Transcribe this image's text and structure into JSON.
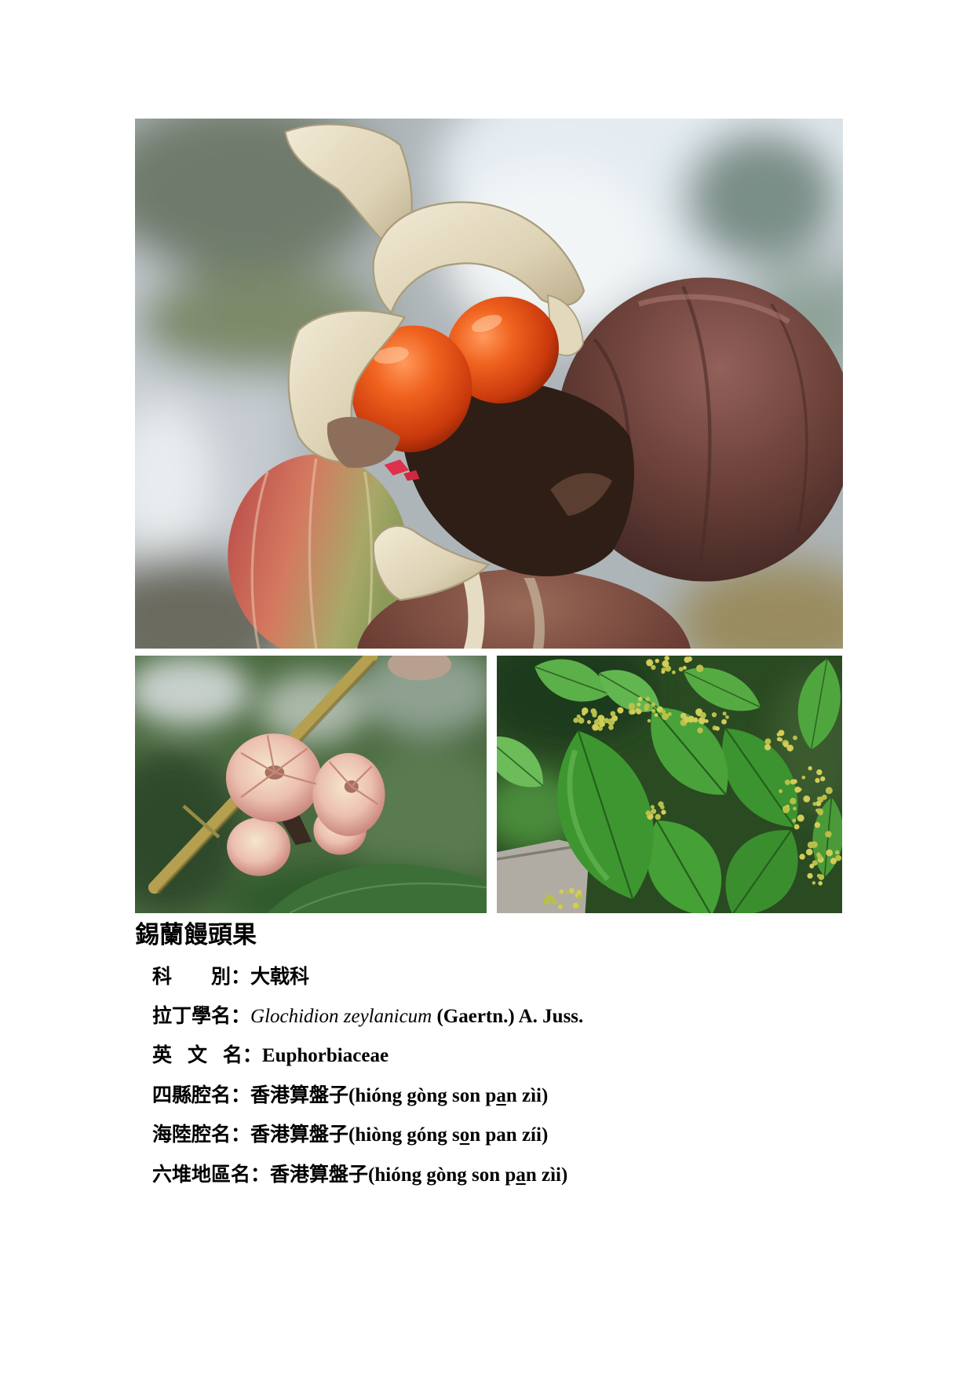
{
  "title": "錫蘭饅頭果",
  "fields": {
    "family": {
      "label": "科　　別：",
      "value": "大戟科"
    },
    "latin": {
      "label": "拉丁學名：",
      "binomial": "Glochidion zeylanicum",
      "authority": " (Gaertn.) A. Juss."
    },
    "english": {
      "label": "英 文 名：",
      "value": "Euphorbiaceae"
    },
    "sixian": {
      "label": "四縣腔名：",
      "name": "香港算盤子",
      "pron_before": "(hióng gòng son p",
      "pron_underlined": "a",
      "pron_after": "n zìi)"
    },
    "hailu": {
      "label": "海陸腔名：",
      "name": "香港算盤子",
      "pron_before": "(hiòng góng s",
      "pron_underlined": "o",
      "pron_after": "n pan zíi)"
    },
    "liudui": {
      "label": "六堆地區名：",
      "name": "香港算盤子",
      "pron_before": "(hióng gòng son p",
      "pron_underlined": "a",
      "pron_after": "n zìi)"
    }
  }
}
